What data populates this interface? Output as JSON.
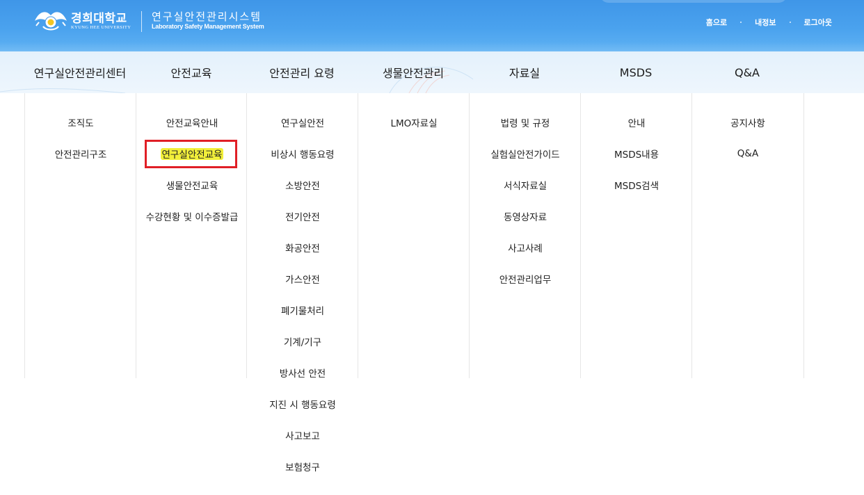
{
  "header": {
    "university_name": "경희대학교",
    "university_name_en": "KYUNG HEE UNIVERSITY",
    "system_name": "연구실안전관리시스템",
    "system_name_en": "Laboratory Safety Management System",
    "util_links": [
      "홈으로",
      "내정보",
      "로그아웃"
    ]
  },
  "nav": {
    "menus": [
      {
        "label": "연구실안전관리센터",
        "items": [
          "조직도",
          "안전관리구조"
        ]
      },
      {
        "label": "안전교육",
        "items": [
          "안전교육안내",
          "연구실안전교육",
          "생물안전교육",
          "수강현황 및 이수증발급"
        ]
      },
      {
        "label": "안전관리 요령",
        "items": [
          "연구실안전",
          "비상시 행동요령",
          "소방안전",
          "전기안전",
          "화공안전",
          "가스안전",
          "폐기물처리",
          "기계/기구",
          "방사선 안전",
          "지진 시 행동요령",
          "사고보고",
          "보험청구"
        ]
      },
      {
        "label": "생물안전관리",
        "items": [
          "LMO자료실"
        ]
      },
      {
        "label": "자료실",
        "items": [
          "법령 및 규정",
          "실험실안전가이드",
          "서식자료실",
          "동영상자료",
          "사고사례",
          "안전관리업무"
        ]
      },
      {
        "label": "MSDS",
        "items": [
          "안내",
          "MSDS내용",
          "MSDS검색"
        ]
      },
      {
        "label": "Q&A",
        "items": [
          "공지사항",
          "Q&A"
        ]
      }
    ]
  },
  "highlighted_item": "연구실안전교육",
  "colors": {
    "header_blue": "#4aa2ee",
    "nav_bg": "#e8f3fd",
    "highlight": "#f2ef3a",
    "annotation_red": "#e01f26"
  }
}
